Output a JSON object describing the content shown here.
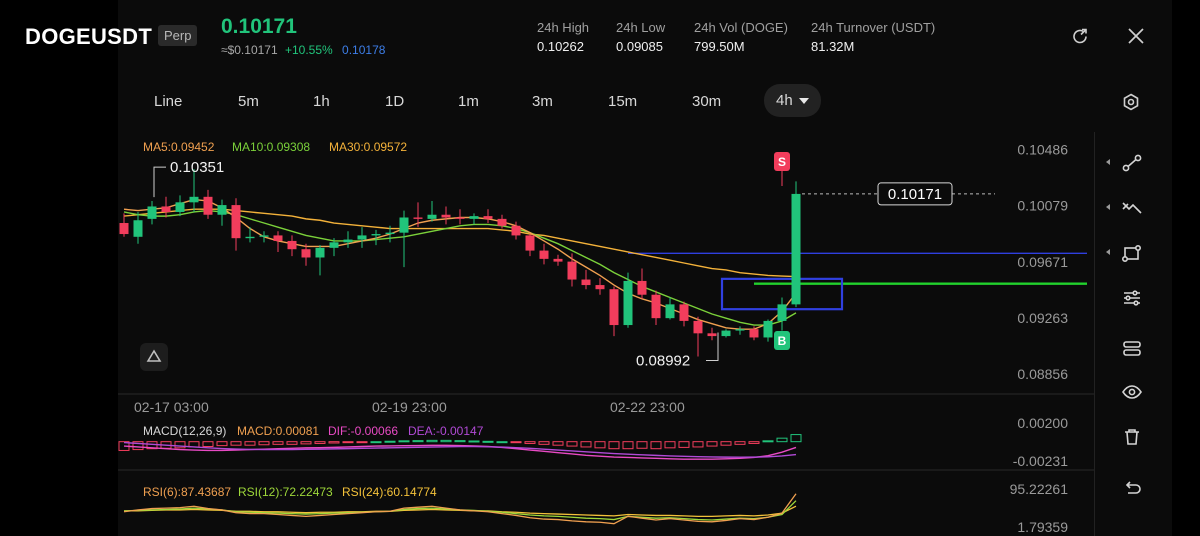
{
  "header": {
    "symbol": "DOGEUSDT",
    "contract_type": "Perp",
    "last_price": "0.10171",
    "approx_usd": "≈$0.10171",
    "change_pct": "+10.55%",
    "mark_price": "0.10178",
    "stats": [
      {
        "label": "24h  High",
        "value": "0.10262"
      },
      {
        "label": "24h  Low",
        "value": "0.09085"
      },
      {
        "label": "24h  Vol (DOGE)",
        "value": "799.50M"
      },
      {
        "label": "24h  Turnover (USDT)",
        "value": "81.32M"
      }
    ],
    "icons": {
      "share": "share-icon",
      "close": "close-icon"
    }
  },
  "timeframes": [
    "Line",
    "5m",
    "1h",
    "1D",
    "1m",
    "3m",
    "15m",
    "30m",
    "4h"
  ],
  "active_timeframe": "4h",
  "side_tools": [
    "line-tool-icon",
    "trend-tool-icon",
    "shape-tool-icon",
    "indicator-settings-icon",
    "template-icon",
    "visibility-icon",
    "delete-icon",
    "undo-icon"
  ],
  "colors": {
    "up": "#21c47b",
    "down": "#f23d5c",
    "ma5": "#f0a050",
    "ma10": "#7bd13a",
    "ma30": "#f4b23a",
    "dif": "#e84ac4",
    "dea": "#b14ad6",
    "rsi6": "#f0a050",
    "rsi12": "#9ed83a",
    "rsi24": "#f4c23a",
    "hline_blue": "#2f3fe0",
    "hline_green": "#22d12c",
    "rect": "#3040e0"
  },
  "chart_data": [
    {
      "type": "candlestick",
      "title": "",
      "ma_labels": [
        "MA5:0.09452",
        "MA10:0.09308",
        "MA30:0.09572"
      ],
      "y_ticks": [
        "0.10486",
        "0.10079",
        "0.09671",
        "0.09263",
        "0.08856"
      ],
      "y_tick_values": [
        0.10486,
        0.10079,
        0.09671,
        0.09263,
        0.08856
      ],
      "x_ticks": [
        "02-17 03:00",
        "02-19 23:00",
        "02-22 23:00"
      ],
      "x_tick_index": [
        1,
        18,
        35
      ],
      "ylim": [
        0.0872,
        0.1062
      ],
      "current_price_label": "0.10171",
      "high_annotation": "0.10351",
      "low_annotation": "0.08992",
      "high_index": 5,
      "low_index": 41,
      "signals": [
        {
          "label": "S",
          "index": 47
        },
        {
          "label": "B",
          "index": 47
        }
      ],
      "hlines": [
        {
          "value": 0.0974,
          "color": "blue"
        },
        {
          "value": 0.0952,
          "color": "green"
        }
      ],
      "rect": {
        "i0": 43,
        "i1": 51,
        "y0": 0.09555,
        "y1": 0.09335
      },
      "ohlc": [
        [
          0.0996,
          0.1003,
          0.0988,
          0.0986
        ],
        [
          0.0986,
          0.1004,
          0.0998,
          0.0981
        ],
        [
          0.0999,
          0.1012,
          0.1008,
          0.0995
        ],
        [
          0.1008,
          0.1015,
          0.1004,
          0.1
        ],
        [
          0.1004,
          0.1016,
          0.1011,
          0.1001
        ],
        [
          0.1011,
          0.10351,
          0.1015,
          0.1004
        ],
        [
          0.1015,
          0.102,
          0.1002,
          0.0999
        ],
        [
          0.1002,
          0.1013,
          0.1009,
          0.0994
        ],
        [
          0.1009,
          0.1014,
          0.0985,
          0.0976
        ],
        [
          0.0985,
          0.0993,
          0.0986,
          0.0982
        ],
        [
          0.0986,
          0.099,
          0.0987,
          0.0982
        ],
        [
          0.0987,
          0.099,
          0.0983,
          0.0975
        ],
        [
          0.0983,
          0.0987,
          0.0977,
          0.0972
        ],
        [
          0.0977,
          0.0981,
          0.0971,
          0.0965
        ],
        [
          0.0971,
          0.098,
          0.0978,
          0.0958
        ],
        [
          0.0978,
          0.0985,
          0.0982,
          0.0972
        ],
        [
          0.0982,
          0.099,
          0.0984,
          0.0978
        ],
        [
          0.0984,
          0.0993,
          0.0987,
          0.0978
        ],
        [
          0.0987,
          0.0991,
          0.0988,
          0.098
        ],
        [
          0.0988,
          0.0994,
          0.0989,
          0.0982
        ],
        [
          0.0989,
          0.1005,
          0.1,
          0.0964
        ],
        [
          0.1,
          0.1011,
          0.0999,
          0.0993
        ],
        [
          0.0999,
          0.1012,
          0.1002,
          0.0997
        ],
        [
          0.1002,
          0.1008,
          0.1,
          0.0995
        ],
        [
          0.1,
          0.1006,
          0.0999,
          0.0995
        ],
        [
          0.0999,
          0.1003,
          0.1001,
          0.0995
        ],
        [
          0.1001,
          0.1006,
          0.0999,
          0.0996
        ],
        [
          0.0999,
          0.1002,
          0.0994,
          0.0992
        ],
        [
          0.0994,
          0.0997,
          0.0987,
          0.0984
        ],
        [
          0.0987,
          0.0988,
          0.0976,
          0.0972
        ],
        [
          0.0976,
          0.0981,
          0.097,
          0.0966
        ],
        [
          0.097,
          0.0973,
          0.0968,
          0.0965
        ],
        [
          0.0968,
          0.0974,
          0.0955,
          0.095
        ],
        [
          0.0955,
          0.0962,
          0.0951,
          0.0948
        ],
        [
          0.0951,
          0.0956,
          0.0948,
          0.0944
        ],
        [
          0.0948,
          0.095,
          0.0922,
          0.0914
        ],
        [
          0.0922,
          0.096,
          0.0954,
          0.092
        ],
        [
          0.0954,
          0.0963,
          0.0944,
          0.0941
        ],
        [
          0.0944,
          0.0947,
          0.0927,
          0.0922
        ],
        [
          0.0927,
          0.0942,
          0.0937,
          0.0926
        ],
        [
          0.0937,
          0.0939,
          0.0925,
          0.0921
        ],
        [
          0.0925,
          0.0928,
          0.0916,
          0.08992
        ],
        [
          0.0916,
          0.092,
          0.0914,
          0.0911
        ],
        [
          0.0914,
          0.0919,
          0.0918,
          0.0913
        ],
        [
          0.0918,
          0.0921,
          0.0919,
          0.0915
        ],
        [
          0.0919,
          0.0921,
          0.0913,
          0.0911
        ],
        [
          0.0913,
          0.0926,
          0.0925,
          0.091
        ],
        [
          0.0925,
          0.0942,
          0.0937,
          0.0918
        ],
        [
          0.0937,
          0.10262,
          0.10171,
          0.0935
        ]
      ],
      "ma5": [
        0.1006,
        0.1005,
        0.1006,
        0.1007,
        0.101,
        0.1013,
        0.1012,
        0.1007,
        0.1,
        0.0992,
        0.0986,
        0.0983,
        0.0981,
        0.0979,
        0.0979,
        0.0979,
        0.0981,
        0.0983,
        0.0985,
        0.0988,
        0.0992,
        0.0996,
        0.0998,
        0.0999,
        0.1,
        0.1,
        0.0999,
        0.0997,
        0.0994,
        0.0989,
        0.0983,
        0.0977,
        0.097,
        0.0964,
        0.0958,
        0.0951,
        0.0945,
        0.0941,
        0.0938,
        0.0934,
        0.093,
        0.0926,
        0.0923,
        0.092,
        0.0919,
        0.0919,
        0.0923,
        0.0932,
        0.09452
      ],
      "ma10": [
        0.1004,
        0.1002,
        0.1001,
        0.1001,
        0.1002,
        0.1004,
        0.1005,
        0.1004,
        0.1002,
        0.0999,
        0.0996,
        0.0993,
        0.099,
        0.0987,
        0.0985,
        0.0983,
        0.0983,
        0.0983,
        0.0984,
        0.0985,
        0.0986,
        0.0988,
        0.099,
        0.0992,
        0.0994,
        0.0995,
        0.0995,
        0.0994,
        0.0992,
        0.0989,
        0.0985,
        0.0981,
        0.0976,
        0.0971,
        0.0966,
        0.096,
        0.0955,
        0.095,
        0.0946,
        0.0942,
        0.0938,
        0.0934,
        0.093,
        0.0927,
        0.0924,
        0.0922,
        0.0922,
        0.0925,
        0.09308
      ],
      "ma30": [
        0.1001,
        0.1002,
        0.1003,
        0.1004,
        0.1005,
        0.1006,
        0.1006,
        0.1006,
        0.1005,
        0.1004,
        0.1003,
        0.1002,
        0.1001,
        0.0999,
        0.0998,
        0.0996,
        0.0995,
        0.0994,
        0.0993,
        0.0992,
        0.0992,
        0.0992,
        0.0992,
        0.0992,
        0.0992,
        0.0992,
        0.0992,
        0.0991,
        0.099,
        0.0988,
        0.0987,
        0.0985,
        0.0983,
        0.0981,
        0.0979,
        0.0977,
        0.0975,
        0.0973,
        0.0971,
        0.0969,
        0.0967,
        0.0965,
        0.0963,
        0.0962,
        0.096,
        0.0959,
        0.0958,
        0.09575,
        0.09572
      ]
    },
    {
      "type": "macd",
      "labels": [
        "MACD(12,26,9)",
        "MACD:0.00081",
        "DIF:-0.00066",
        "DEA:-0.00147"
      ],
      "y_ticks": [
        "0.00200",
        "-0.00231"
      ],
      "y_tick_values": [
        0.002,
        -0.00231
      ],
      "ylim": [
        -0.003,
        0.0027
      ],
      "hist": [
        -0.001,
        -0.0009,
        -0.0008,
        -0.00075,
        -0.0007,
        -0.0006,
        -0.00055,
        -0.00045,
        -0.0004,
        -0.0004,
        -0.00035,
        -0.0003,
        -0.0003,
        -0.00025,
        -0.0002,
        -0.00015,
        -0.0001,
        -5e-05,
        0.0,
        5e-05,
        0.0001,
        0.00012,
        0.00015,
        0.00015,
        0.00012,
        8e-05,
        4e-05,
        0.0,
        -0.0001,
        -0.0002,
        -0.0003,
        -0.0004,
        -0.0005,
        -0.0006,
        -0.0007,
        -0.0008,
        -0.0008,
        -0.00075,
        -0.0008,
        -0.0007,
        -0.00065,
        -0.0006,
        -0.0005,
        -0.0004,
        -0.0003,
        -0.0002,
        0.0001,
        0.0004,
        0.00081
      ],
      "dif": [
        -0.0005,
        -0.0006,
        -0.0007,
        -0.0008,
        -0.0009,
        -0.00095,
        -0.001,
        -0.001,
        -0.00095,
        -0.0009,
        -0.00085,
        -0.0008,
        -0.00075,
        -0.0007,
        -0.00068,
        -0.00065,
        -0.0006,
        -0.00055,
        -0.0005,
        -0.00048,
        -0.00046,
        -0.00044,
        -0.00042,
        -0.00042,
        -0.00044,
        -0.00048,
        -0.00055,
        -0.00065,
        -0.0008,
        -0.00095,
        -0.0011,
        -0.00125,
        -0.0014,
        -0.00155,
        -0.00165,
        -0.00175,
        -0.0018,
        -0.00185,
        -0.0019,
        -0.00195,
        -0.002,
        -0.002,
        -0.002,
        -0.00195,
        -0.0019,
        -0.0018,
        -0.0016,
        -0.0012,
        -0.00066
      ],
      "dea": [
        -0.0001,
        -0.0002,
        -0.0003,
        -0.0004,
        -0.0005,
        -0.0006,
        -0.0007,
        -0.00078,
        -0.00084,
        -0.00088,
        -0.0009,
        -0.0009,
        -0.00089,
        -0.00087,
        -0.00085,
        -0.00082,
        -0.00079,
        -0.00076,
        -0.00073,
        -0.0007,
        -0.00067,
        -0.00064,
        -0.00061,
        -0.00058,
        -0.00056,
        -0.00056,
        -0.00058,
        -0.00062,
        -0.00068,
        -0.00076,
        -0.00085,
        -0.00095,
        -0.00105,
        -0.00115,
        -0.00125,
        -0.00135,
        -0.00143,
        -0.0015,
        -0.00156,
        -0.00162,
        -0.00167,
        -0.00171,
        -0.00174,
        -0.00176,
        -0.00177,
        -0.00176,
        -0.00172,
        -0.00162,
        -0.00147
      ]
    },
    {
      "type": "rsi",
      "labels": [
        "RSI(6):87.43687",
        "RSI(12):72.22473",
        "RSI(24):60.14774"
      ],
      "y_ticks": [
        "95.22261",
        "1.79359"
      ],
      "y_tick_values": [
        95.22261,
        1.79359
      ],
      "ylim": [
        -5,
        100
      ],
      "rsi6": [
        48,
        52,
        55,
        56,
        57,
        60,
        55,
        52,
        46,
        44,
        44,
        42,
        40,
        38,
        40,
        42,
        44,
        46,
        48,
        49,
        56,
        58,
        60,
        56,
        52,
        50,
        48,
        44,
        40,
        35,
        32,
        31,
        28,
        26,
        25,
        22,
        38,
        34,
        30,
        33,
        30,
        27,
        26,
        29,
        33,
        31,
        36,
        45,
        87.44
      ],
      "rsi12": [
        50,
        51,
        52,
        53,
        54,
        56,
        54,
        52,
        48,
        47,
        46,
        45,
        44,
        43,
        44,
        45,
        46,
        47,
        48,
        49,
        53,
        55,
        56,
        54,
        52,
        51,
        49,
        47,
        44,
        41,
        39,
        38,
        36,
        34,
        33,
        31,
        38,
        36,
        34,
        35,
        33,
        31,
        30,
        32,
        34,
        33,
        36,
        42,
        72.22
      ],
      "rsi24": [
        50,
        50,
        51,
        52,
        52,
        53,
        52,
        51,
        49,
        49,
        48,
        48,
        47,
        46,
        47,
        47,
        48,
        48,
        49,
        49,
        51,
        52,
        53,
        52,
        51,
        50,
        50,
        48,
        47,
        45,
        44,
        43,
        42,
        41,
        40,
        39,
        42,
        41,
        40,
        40,
        39,
        38,
        38,
        39,
        40,
        39,
        41,
        45,
        60.15
      ]
    }
  ]
}
